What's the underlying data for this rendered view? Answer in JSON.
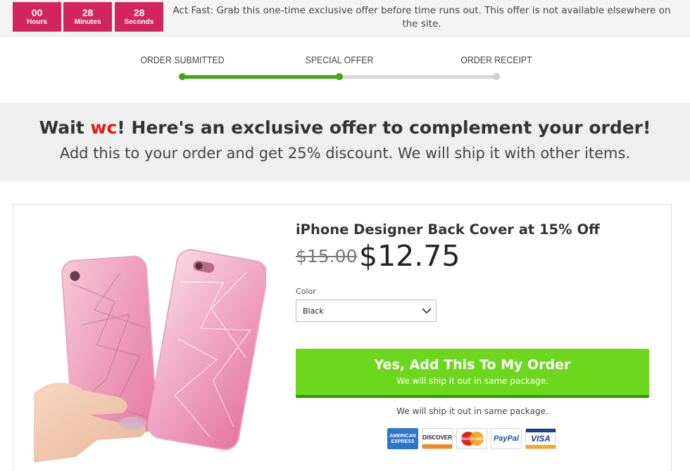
{
  "countdown": {
    "hours": "00",
    "hours_label": "Hours",
    "minutes": "28",
    "minutes_label": "Minutes",
    "seconds": "28",
    "seconds_label": "Seconds",
    "message": "Act Fast: Grab this one-time exclusive offer before time runs out. This offer is not available elsewhere on the site."
  },
  "steps": [
    {
      "label": "ORDER SUBMITTED",
      "state": "done"
    },
    {
      "label": "SPECIAL OFFER",
      "state": "current"
    },
    {
      "label": "ORDER RECEIPT",
      "state": "pending"
    }
  ],
  "headline": {
    "prefix": "Wait ",
    "name": "wc",
    "suffix": "! Here's an exclusive offer to complement your order!",
    "subtitle": "Add this to your order and get 25% discount. We will ship it with other items."
  },
  "product": {
    "title": "iPhone Designer Back Cover at 15% Off",
    "old_price": "$15.00",
    "new_price": "$12.75",
    "color_label": "Color",
    "color_value": "Black"
  },
  "cta": {
    "label": "Yes, Add This To My Order",
    "sublabel": "We will ship it out in same package."
  },
  "shipping_note": "We will ship it out in same package.",
  "payment_cards": [
    "AMERICAN EXPRESS",
    "DISCOVER",
    "MasterCard",
    "PayPal",
    "VISA"
  ],
  "colors": {
    "countdown": "#d2255f",
    "progress": "#3faa10",
    "cta": "#6dd61e",
    "highlight": "#e01b1b"
  }
}
